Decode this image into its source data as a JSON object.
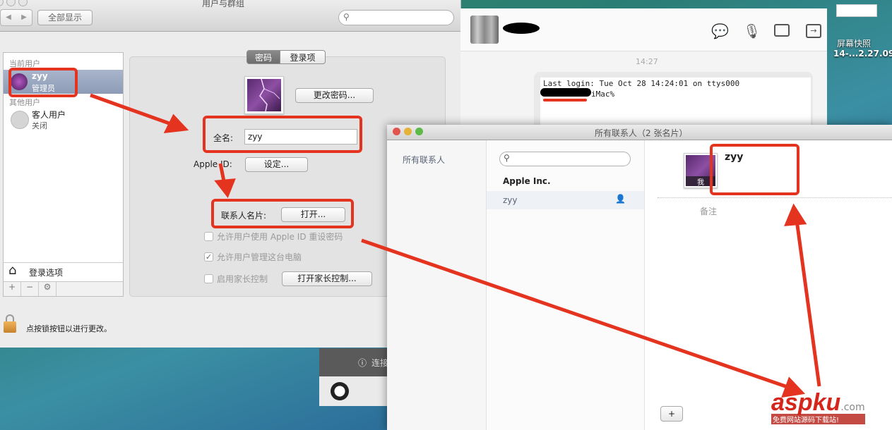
{
  "users_groups": {
    "window_title": "用户与群组",
    "show_all_label": "全部显示",
    "search_placeholder": "",
    "sidebar": {
      "current_users_label": "当前用户",
      "current_user": {
        "name": "zyy",
        "role": "管理员"
      },
      "other_users_label": "其他用户",
      "guest_user": {
        "name": "客人用户",
        "status": "关闭"
      },
      "login_options_label": "登录选项",
      "add_label": "+",
      "remove_label": "−",
      "gear_label": "⚙"
    },
    "tabs": [
      {
        "label": "密码",
        "selected": true
      },
      {
        "label": "登录项",
        "selected": false
      }
    ],
    "change_password_label": "更改密码...",
    "full_name_label": "全名:",
    "full_name_value": "zyy",
    "apple_id_label": "Apple ID:",
    "apple_id_button": "设定...",
    "contact_card_label": "联系人名片:",
    "contact_card_button": "打开...",
    "checkboxes": [
      {
        "label": "允许用户使用 Apple ID 重设密码",
        "checked": false,
        "enabled": false
      },
      {
        "label": "允许用户管理这台电脑",
        "checked": true,
        "enabled": false
      },
      {
        "label": "启用家长控制",
        "checked": false,
        "enabled": false
      }
    ],
    "parental_controls_button": "打开家长控制...",
    "lock_message": "点按锁按钮以进行更改。"
  },
  "chat": {
    "timestamp": "14:27",
    "terminal_lines": [
      "Last login: Tue Oct 28 14:24:01 on ttys000",
      "iMac% "
    ],
    "icons": [
      "add-chat-icon",
      "microphone-icon",
      "video-icon",
      "share-icon"
    ]
  },
  "desktop_icon": {
    "line1": "屏幕快照",
    "line2": "14-...2.27.09"
  },
  "notification": {
    "text": "连接"
  },
  "contacts": {
    "window_title": "所有联系人（2 张名片）",
    "groups": [
      "所有联系人"
    ],
    "search_placeholder": "",
    "list": [
      {
        "name": "Apple Inc.",
        "bold": true,
        "selected": false
      },
      {
        "name": "zyy",
        "bold": false,
        "selected": true
      }
    ],
    "card": {
      "name": "zyy",
      "me_badge": "我",
      "note_label": "备注"
    },
    "add_button": "+"
  },
  "watermark": {
    "brand": "aspku",
    "suffix": ".com",
    "tagline": "免费网站源码下载站!"
  },
  "colors": {
    "annotation_red": "#e4331f",
    "selection_blue": "#9aa8c2"
  }
}
